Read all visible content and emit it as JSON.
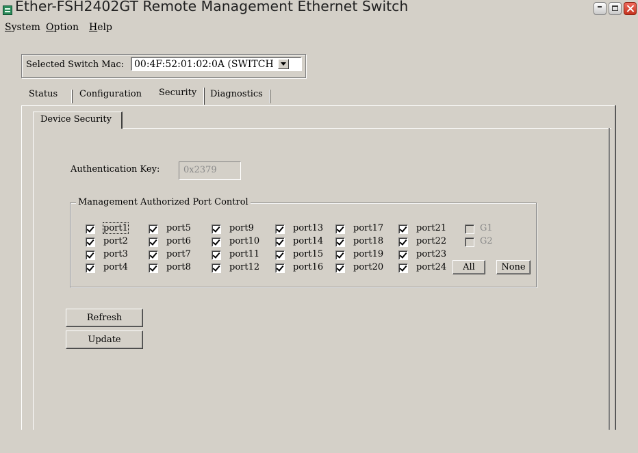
{
  "window": {
    "title": "Ether-FSH2402GT Remote Management Ethernet Switch"
  },
  "menu": [
    {
      "label": "System"
    },
    {
      "label": "Option"
    },
    {
      "label": "Help"
    }
  ],
  "switch_selector": {
    "label": "Selected Switch Mac:",
    "value": "00:4F:52:01:02:0A (SWITCH"
  },
  "tabs": [
    {
      "label": "Status"
    },
    {
      "label": "Configuration"
    },
    {
      "label": "Security",
      "active": true
    },
    {
      "label": "Diagnostics"
    }
  ],
  "subtab": {
    "label": "Device Security"
  },
  "auth": {
    "label": "Authentication Key:",
    "value": "0x2379"
  },
  "port_control": {
    "title": "Management Authorized Port Control",
    "ports": [
      {
        "label": "port1",
        "checked": true
      },
      {
        "label": "port2",
        "checked": true
      },
      {
        "label": "port3",
        "checked": true
      },
      {
        "label": "port4",
        "checked": true
      },
      {
        "label": "port5",
        "checked": true
      },
      {
        "label": "port6",
        "checked": true
      },
      {
        "label": "port7",
        "checked": true
      },
      {
        "label": "port8",
        "checked": true
      },
      {
        "label": "port9",
        "checked": true
      },
      {
        "label": "port10",
        "checked": true
      },
      {
        "label": "port11",
        "checked": true
      },
      {
        "label": "port12",
        "checked": true
      },
      {
        "label": "port13",
        "checked": true
      },
      {
        "label": "port14",
        "checked": true
      },
      {
        "label": "port15",
        "checked": true
      },
      {
        "label": "port16",
        "checked": true
      },
      {
        "label": "port17",
        "checked": true
      },
      {
        "label": "port18",
        "checked": true
      },
      {
        "label": "port19",
        "checked": true
      },
      {
        "label": "port20",
        "checked": true
      },
      {
        "label": "port21",
        "checked": true
      },
      {
        "label": "port22",
        "checked": true
      },
      {
        "label": "port23",
        "checked": true
      },
      {
        "label": "port24",
        "checked": true
      }
    ],
    "gigabit": [
      {
        "label": "G1",
        "checked": false,
        "disabled": true
      },
      {
        "label": "G2",
        "checked": false,
        "disabled": true
      }
    ],
    "all_label": "All",
    "none_label": "None"
  },
  "actions": {
    "refresh_label": "Refresh",
    "update_label": "Update"
  }
}
